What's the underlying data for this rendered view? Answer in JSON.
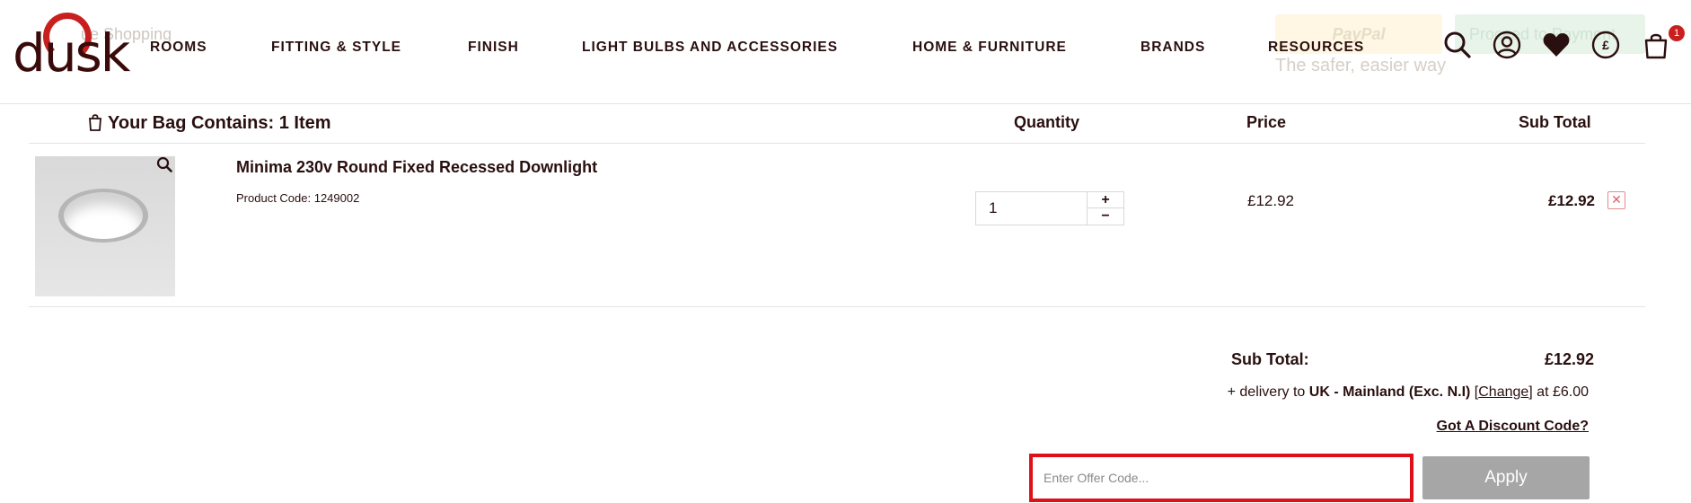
{
  "header": {
    "logo_text": "dusk",
    "background": {
      "continue_shopping": "ue Shopping",
      "paypal_label": "PayPal",
      "paypal_tagline": "The safer, easier way",
      "proceed_label": "Proceed to Payment"
    },
    "nav": [
      {
        "label": "ROOMS"
      },
      {
        "label": "FITTING & STYLE"
      },
      {
        "label": "FINISH"
      },
      {
        "label": "LIGHT BULBS AND ACCESSORIES"
      },
      {
        "label": "HOME & FURNITURE"
      },
      {
        "label": "BRANDS"
      },
      {
        "label": "RESOURCES"
      }
    ],
    "icons": [
      "search-icon",
      "account-icon",
      "wishlist-heart-icon",
      "currency-pound-icon",
      "shopping-bag-icon"
    ],
    "currency_symbol": "£",
    "cart_count": "1"
  },
  "bag": {
    "title": "Your Bag Contains: 1 Item",
    "columns": {
      "quantity": "Quantity",
      "price": "Price",
      "subtotal": "Sub Total"
    },
    "items": [
      {
        "name": "Minima 230v Round Fixed Recessed Downlight",
        "code": "Product Code: 1249002",
        "quantity": "1",
        "plus": "+",
        "minus": "−",
        "price": "£12.92",
        "subtotal": "£12.92",
        "remove": "✕"
      }
    ]
  },
  "totals": {
    "label": "Sub Total:",
    "value": "£12.92",
    "delivery_prefix": "+ delivery to ",
    "delivery_region": "UK - Mainland (Exc. N.I)",
    "delivery_open": " [",
    "delivery_change": "Change",
    "delivery_close": "] at £6.00",
    "discount_link": "Got A Discount Code?",
    "offer_placeholder": "Enter Offer Code...",
    "apply_label": "Apply"
  },
  "colors": {
    "brand": "#c8201f",
    "text": "#2a0f0f",
    "highlight_border": "#e0101a",
    "apply_bg": "#a6a6a6"
  }
}
